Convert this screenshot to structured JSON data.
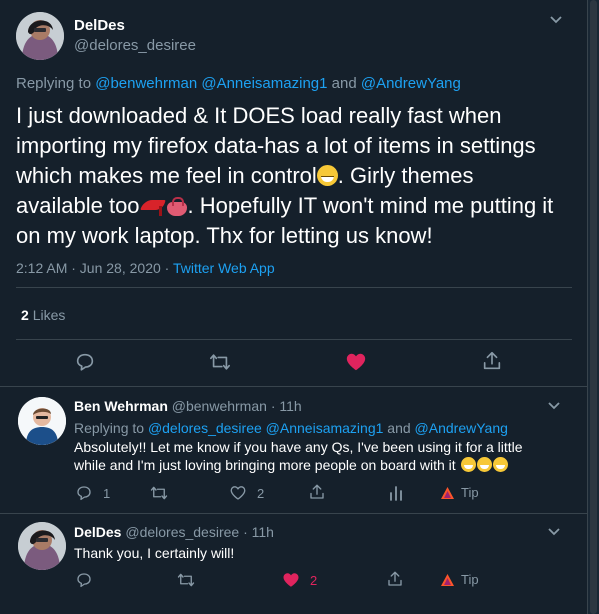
{
  "main": {
    "name": "DelDes",
    "handle": "@delores_desiree",
    "replying_label": "Replying to",
    "reply_mention_1": "@benwehrman",
    "reply_mention_2": "@Anneisamazing1",
    "reply_and": "and",
    "reply_mention_3": "@AndrewYang",
    "text_part_1": "I just downloaded & It DOES load really fast when importing my firefox data-has a lot of items in settings which makes me feel in control",
    "text_part_2": ". Girly themes available too",
    "text_part_3": ". Hopefully IT won't mind me putting it on my work laptop. Thx for letting us know!",
    "timestamp": "2:12 AM · Jun 28, 2020 · ",
    "source": "Twitter Web App",
    "likes_count": "2",
    "likes_label": "Likes",
    "liked": true
  },
  "reply1": {
    "name": "Ben Wehrman",
    "handle": "@benwehrman",
    "time": "· 11h",
    "replying_label": "Replying to",
    "mention_1": "@delores_desiree",
    "mention_2": "@Anneisamazing1",
    "and": "and",
    "mention_3": "@AndrewYang",
    "text": "Absolutely!! Let me know if you have any Qs, I've been using it for a little while and I'm just loving bringing more people on board with it",
    "reply_count": "1",
    "like_count": "2",
    "tip_label": "Tip"
  },
  "reply2": {
    "name": "DelDes",
    "handle": "@delores_desiree",
    "time": "· 11h",
    "text": "Thank you, I certainly will!",
    "like_count": "2",
    "tip_label": "Tip"
  },
  "colors": {
    "background": "#15202b",
    "accent": "#1da1f2",
    "muted": "#8899a6",
    "like": "#e0245e",
    "divider": "#38444d"
  }
}
